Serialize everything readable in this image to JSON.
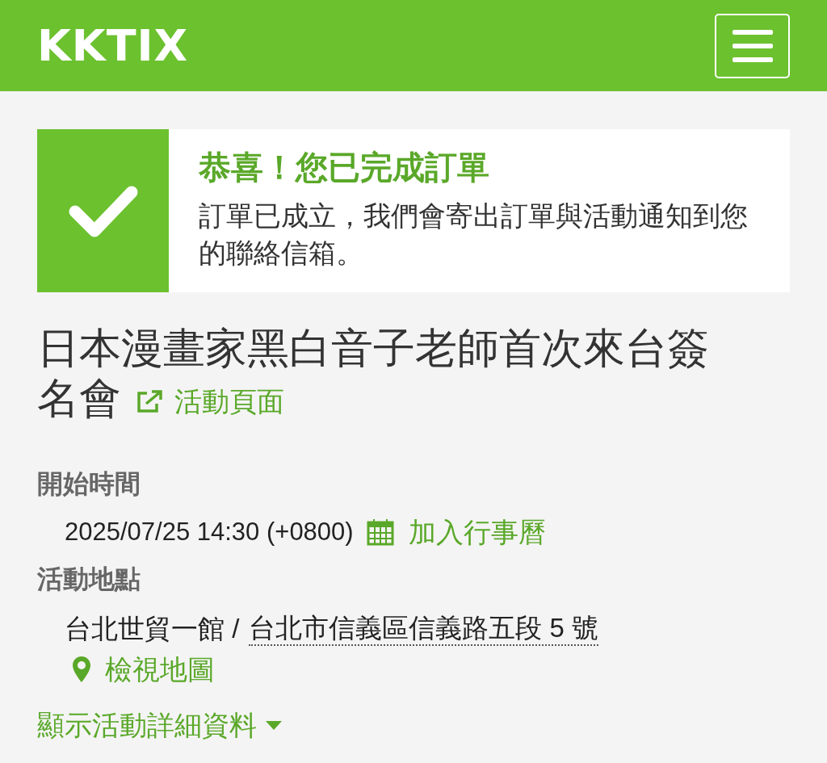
{
  "header": {
    "logo": "KKTIX"
  },
  "alert": {
    "title": "恭喜！您已完成訂單",
    "message": "訂單已成立，我們會寄出訂單與活動通知到您的聯絡信箱。"
  },
  "event": {
    "title_lines": [
      "日本漫畫家黑白音子老師首次來台簽",
      "名會"
    ],
    "page_link": "活動頁面"
  },
  "start": {
    "label": "開始時間",
    "value": "2025/07/25 14:30 (+0800)",
    "calendar_link": "加入行事曆"
  },
  "location": {
    "label": "活動地點",
    "venue": "台北世貿一館 /",
    "address": "台北市信義區信義路五段 5 號",
    "map_link": "檢視地圖"
  },
  "details_toggle": {
    "label": "顯示活動詳細資料",
    "expanded": false
  }
}
